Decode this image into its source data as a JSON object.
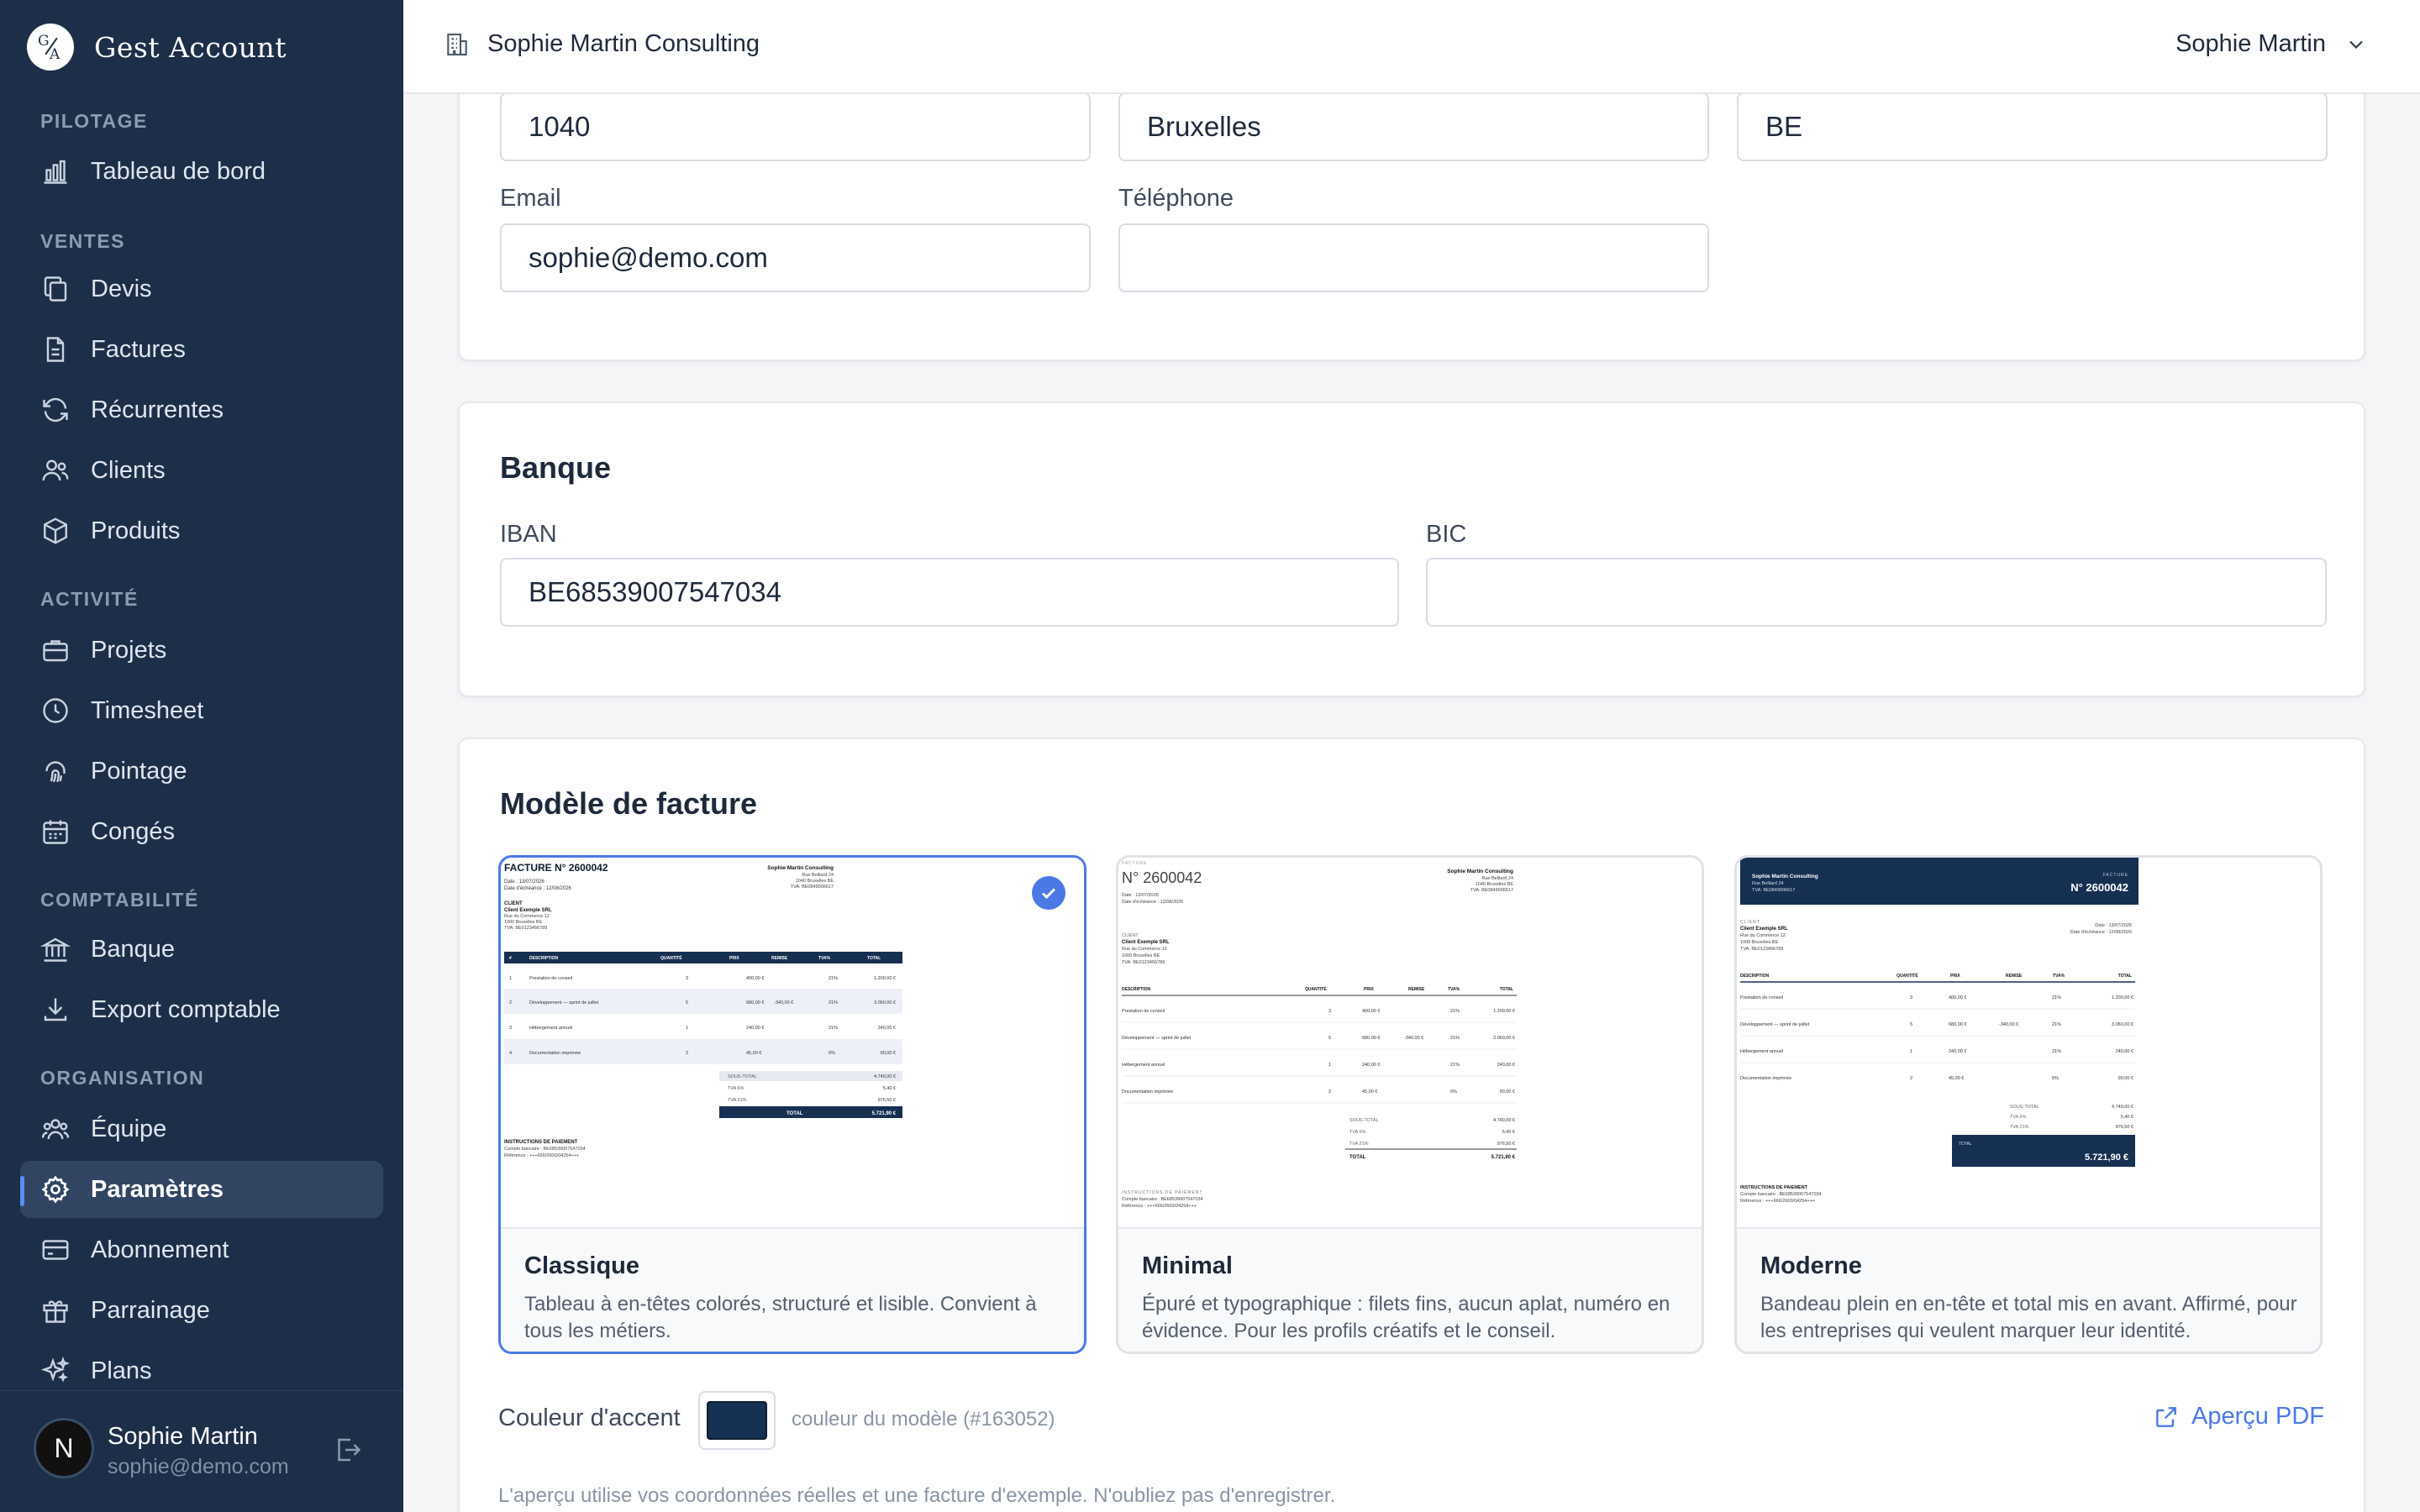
{
  "app": {
    "name": "Gest Account",
    "logo_letters": [
      "G",
      "A"
    ]
  },
  "sidebar": {
    "sections": [
      {
        "title": "PILOTAGE",
        "items": [
          {
            "label": "Tableau de bord",
            "icon": "bar-chart-icon"
          }
        ]
      },
      {
        "title": "VENTES",
        "items": [
          {
            "label": "Devis",
            "icon": "copy-icon"
          },
          {
            "label": "Factures",
            "icon": "file-icon"
          },
          {
            "label": "Récurrentes",
            "icon": "refresh-icon"
          },
          {
            "label": "Clients",
            "icon": "users-icon"
          },
          {
            "label": "Produits",
            "icon": "box-icon"
          }
        ]
      },
      {
        "title": "ACTIVITÉ",
        "items": [
          {
            "label": "Projets",
            "icon": "briefcase-icon"
          },
          {
            "label": "Timesheet",
            "icon": "clock-icon"
          },
          {
            "label": "Pointage",
            "icon": "fingerprint-icon"
          },
          {
            "label": "Congés",
            "icon": "calendar-icon"
          }
        ]
      },
      {
        "title": "COMPTABILITÉ",
        "items": [
          {
            "label": "Banque",
            "icon": "bank-icon"
          },
          {
            "label": "Export comptable",
            "icon": "download-icon"
          }
        ]
      },
      {
        "title": "ORGANISATION",
        "items": [
          {
            "label": "Équipe",
            "icon": "team-icon"
          },
          {
            "label": "Paramètres",
            "icon": "gear-icon",
            "active": true
          },
          {
            "label": "Abonnement",
            "icon": "credit-card-icon"
          },
          {
            "label": "Parrainage",
            "icon": "gift-icon"
          },
          {
            "label": "Plans",
            "icon": "sparkles-icon"
          }
        ]
      }
    ],
    "user": {
      "initial": "N",
      "name": "Sophie Martin",
      "email": "sophie@demo.com"
    }
  },
  "topbar": {
    "company": "Sophie Martin Consulting",
    "user": "Sophie Martin"
  },
  "address": {
    "postal_code": "1040",
    "city": "Bruxelles",
    "country": "BE"
  },
  "contact": {
    "email_label": "Email",
    "email": "sophie@demo.com",
    "phone_label": "Téléphone",
    "phone": ""
  },
  "bank": {
    "title": "Banque",
    "iban_label": "IBAN",
    "iban": "BE68539007547034",
    "bic_label": "BIC",
    "bic": ""
  },
  "invoice_template": {
    "title": "Modèle de facture",
    "templates": [
      {
        "name": "Classique",
        "desc": "Tableau à en-têtes colorés, structuré et lisible. Convient à tous les métiers.",
        "selected": true
      },
      {
        "name": "Minimal",
        "desc": "Épuré et typographique : filets fins, aucun aplat, numéro en évidence. Pour les profils créatifs et le conseil.",
        "selected": false
      },
      {
        "name": "Moderne",
        "desc": "Bandeau plein en en-tête et total mis en avant. Affirmé, pour les entreprises qui veulent marquer leur identité.",
        "selected": false
      }
    ],
    "preview": {
      "invoice_label": "FACTURE",
      "number_title": "FACTURE N° 2600042",
      "number": "N° 2600042",
      "company": "Sophie Martin Consulting",
      "company_lines": [
        "Rue Belliard 24",
        "1040 Bruxelles BE",
        "TVA: BE0849006617"
      ],
      "date_label": "Date : 13/07/2026",
      "due_label": "Date d'échéance : 12/08/2026",
      "client_label": "CLIENT",
      "client_name": "Client Exemple SRL",
      "client_lines": [
        "Rue du Commerce 12",
        "1000 Bruxelles BE",
        "TVA: BE0123456789"
      ],
      "columns": [
        "#",
        "DESCRIPTION",
        "QUANTITÉ",
        "PRIX",
        "REMISE",
        "TVA%",
        "TOTAL"
      ],
      "rows": [
        [
          "1",
          "Prestation de conseil",
          "3",
          "400,00 €",
          "",
          "21%",
          "1.200,00 €"
        ],
        [
          "2",
          "Développement — sprint de juillet",
          "5",
          "680,00 €",
          "-340,00 €",
          "21%",
          "3.060,00 €"
        ],
        [
          "3",
          "Hébergement annuel",
          "1",
          "240,00 €",
          "",
          "21%",
          "240,00 €"
        ],
        [
          "4",
          "Documentation imprimée",
          "2",
          "45,00 €",
          "",
          "6%",
          "90,00 €"
        ]
      ],
      "subtotal": [
        "SOUS-TOTAL",
        "4.740,00 €"
      ],
      "tva6": [
        "TVA 6%",
        "5,40 €"
      ],
      "tva21": [
        "TVA 21%",
        "976,50 €"
      ],
      "total": [
        "TOTAL",
        "5.721,90 €"
      ],
      "payment_title": "INSTRUCTIONS DE PAIEMENT",
      "payment_lines": [
        "Compte bancaire : BE68539007547034",
        "Référence : +++666/2600/04254+++"
      ]
    },
    "accent_label": "Couleur d'accent",
    "accent_color": "#163052",
    "accent_note": "couleur du modèle (#163052)",
    "preview_pdf": "Aperçu PDF",
    "footnote": "L'aperçu utilise vos coordonnées réelles et une facture d'exemple. N'oubliez pas d'enregistrer."
  }
}
